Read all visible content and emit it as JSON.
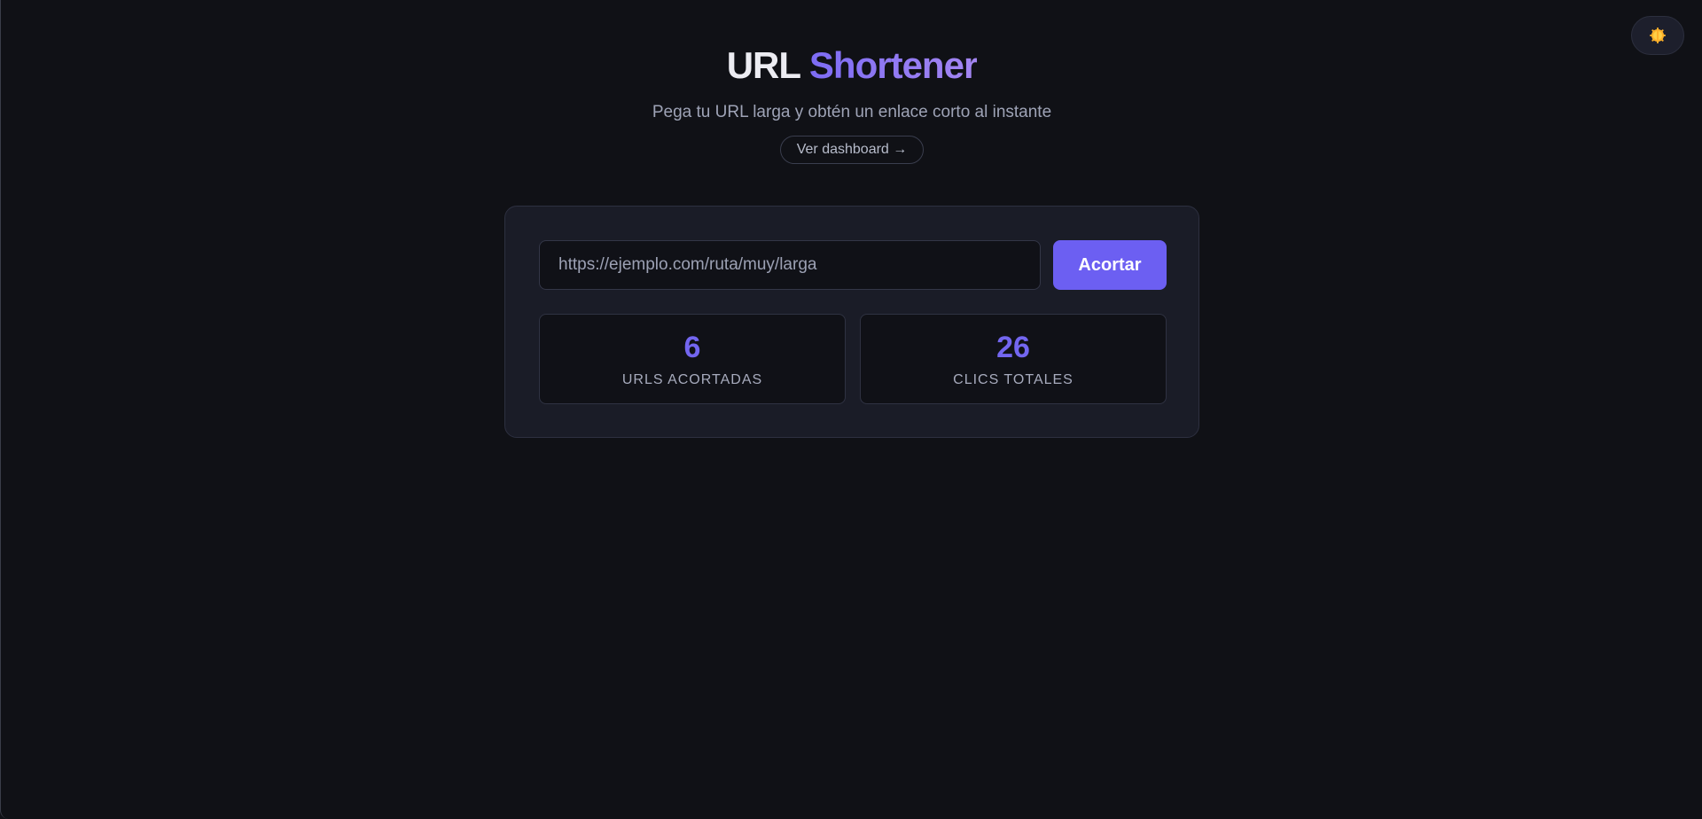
{
  "theme_toggle": {
    "icon": "sun-icon"
  },
  "header": {
    "title_part1": "URL",
    "title_part2": "Shortener",
    "subtitle": "Pega tu URL larga y obtén un enlace corto al instante",
    "dashboard_link": "Ver dashboard →"
  },
  "form": {
    "placeholder": "https://ejemplo.com/ruta/muy/larga",
    "value": "",
    "submit_label": "Acortar"
  },
  "stats": [
    {
      "value": "6",
      "label": "URLS ACORTADAS"
    },
    {
      "value": "26",
      "label": "CLICS TOTALES"
    }
  ],
  "colors": {
    "background": "#101116",
    "card": "#1a1c27",
    "accent": "#6c5ff2",
    "stat_value": "#7366f0"
  }
}
